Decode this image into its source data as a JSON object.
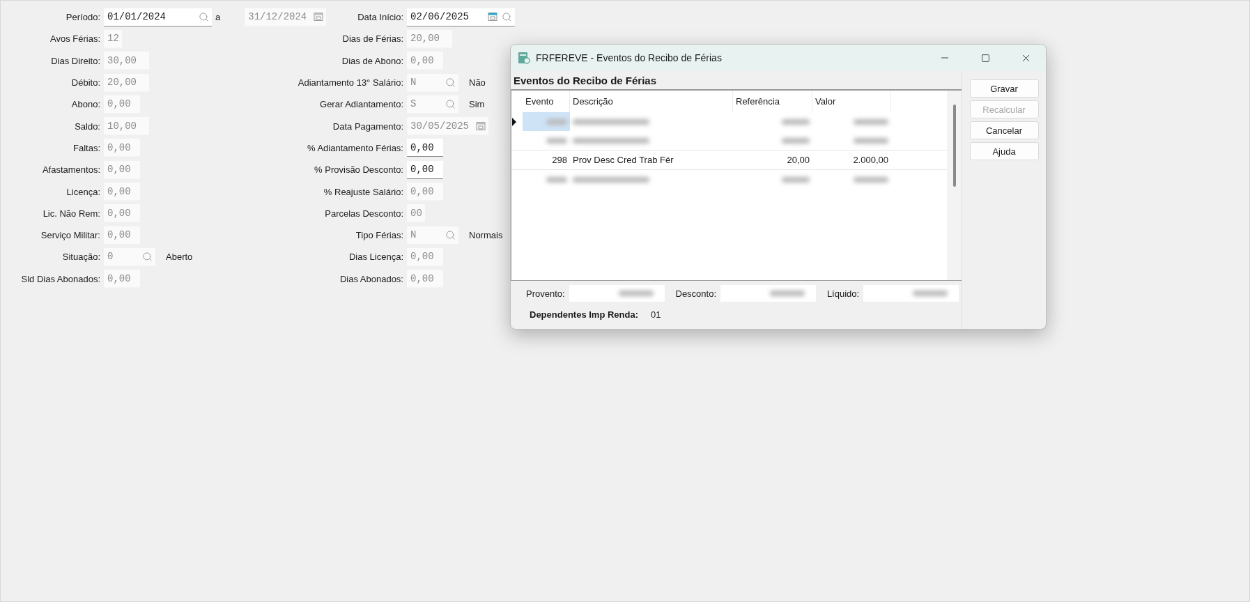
{
  "form": {
    "column_1": [
      {
        "label": "Período:",
        "fields": [
          {
            "value": "01/01/2024",
            "kind": "lookup",
            "disabled": false
          },
          {
            "value": "31/12/2024",
            "kind": "date",
            "disabled": true
          }
        ],
        "between": "a"
      },
      {
        "label": "Avos Férias:",
        "fields": [
          {
            "value": "12",
            "kind": "text",
            "disabled": true
          }
        ]
      },
      {
        "label": "Dias Direito:",
        "fields": [
          {
            "value": "30,00",
            "kind": "text",
            "disabled": true
          }
        ]
      },
      {
        "label": "Débito:",
        "fields": [
          {
            "value": "20,00",
            "kind": "text",
            "disabled": true
          }
        ]
      },
      {
        "label": "Abono:",
        "fields": [
          {
            "value": "0,00",
            "kind": "text",
            "disabled": true
          }
        ]
      },
      {
        "label": "Saldo:",
        "fields": [
          {
            "value": "10,00",
            "kind": "text",
            "disabled": true
          }
        ]
      },
      {
        "label": "Faltas:",
        "fields": [
          {
            "value": "0,00",
            "kind": "text",
            "disabled": true
          }
        ]
      },
      {
        "label": "Afastamentos:",
        "fields": [
          {
            "value": "0,00",
            "kind": "text",
            "disabled": true
          }
        ]
      },
      {
        "label": "Licença:",
        "fields": [
          {
            "value": "0,00",
            "kind": "text",
            "disabled": true
          }
        ]
      },
      {
        "label": "Lic. Não Rem:",
        "fields": [
          {
            "value": "0,00",
            "kind": "text",
            "disabled": true
          }
        ]
      },
      {
        "label": "Serviço Militar:",
        "fields": [
          {
            "value": "0,00",
            "kind": "text",
            "disabled": true
          }
        ]
      },
      {
        "label": "Situação:",
        "fields": [
          {
            "value": "0",
            "kind": "lookup",
            "disabled": true
          }
        ],
        "suffix": "Aberto"
      },
      {
        "label": "Sld Dias Abonados:",
        "fields": [
          {
            "value": "0,00",
            "kind": "text",
            "disabled": true
          }
        ]
      }
    ],
    "column_2": [
      {
        "label": "Data Início:",
        "fields": [
          {
            "value": "02/06/2025",
            "kind": "date_lookup",
            "disabled": false
          }
        ]
      },
      {
        "label": "Dias de Férias:",
        "fields": [
          {
            "value": "20,00",
            "kind": "text",
            "disabled": true
          }
        ]
      },
      {
        "label": "Dias de Abono:",
        "fields": [
          {
            "value": "0,00",
            "kind": "text",
            "disabled": true
          }
        ]
      },
      {
        "label": "Adiantamento 13° Salário:",
        "fields": [
          {
            "value": "N",
            "kind": "lookup",
            "disabled": true
          }
        ],
        "suffix": "Não"
      },
      {
        "label": "Gerar Adiantamento:",
        "fields": [
          {
            "value": "S",
            "kind": "lookup",
            "disabled": true
          }
        ],
        "suffix": "Sim"
      },
      {
        "label": "Data Pagamento:",
        "fields": [
          {
            "value": "30/05/2025",
            "kind": "date",
            "disabled": true
          }
        ]
      },
      {
        "label": "% Adiantamento Férias:",
        "fields": [
          {
            "value": "0,00",
            "kind": "text",
            "disabled": false
          }
        ]
      },
      {
        "label": "% Provisão Desconto:",
        "fields": [
          {
            "value": "0,00",
            "kind": "text",
            "disabled": false
          }
        ]
      },
      {
        "label": "% Reajuste Salário:",
        "fields": [
          {
            "value": "0,00",
            "kind": "text",
            "disabled": true
          }
        ]
      },
      {
        "label": "Parcelas Desconto:",
        "fields": [
          {
            "value": "00",
            "kind": "text",
            "disabled": true
          }
        ]
      },
      {
        "label": "Tipo Férias:",
        "fields": [
          {
            "value": "N",
            "kind": "lookup",
            "disabled": true
          }
        ],
        "suffix": "Normais"
      },
      {
        "label": "Dias Licença:",
        "fields": [
          {
            "value": "0,00",
            "kind": "text",
            "disabled": true
          }
        ]
      },
      {
        "label": "Dias Abonados:",
        "fields": [
          {
            "value": "0,00",
            "kind": "text",
            "disabled": true
          }
        ]
      }
    ]
  },
  "dialog": {
    "title": "FRFEREVE - Eventos do Recibo de Férias",
    "heading": "Eventos do Recibo de Férias",
    "table": {
      "columns": [
        "Evento",
        "Descrição",
        "Referência",
        "Valor"
      ],
      "rows": [
        {
          "kind": "redacted",
          "selected": true
        },
        {
          "kind": "redacted",
          "selected": false
        },
        {
          "kind": "data",
          "selected": false,
          "cells": [
            "298",
            "Prov Desc Cred Trab Fér",
            "20,00",
            "2.000,00"
          ]
        },
        {
          "kind": "redacted",
          "selected": false
        }
      ]
    },
    "totals": [
      {
        "label": "Provento:"
      },
      {
        "label": "Desconto:"
      },
      {
        "label": "Líquido:"
      }
    ],
    "dependents": {
      "label": "Dependentes Imp Renda:",
      "value": "01"
    },
    "buttons": [
      {
        "label": "Gravar",
        "disabled": false
      },
      {
        "label": "Recalcular",
        "disabled": true
      },
      {
        "label": "Cancelar",
        "disabled": false
      },
      {
        "label": "Ajuda",
        "disabled": false
      }
    ]
  }
}
